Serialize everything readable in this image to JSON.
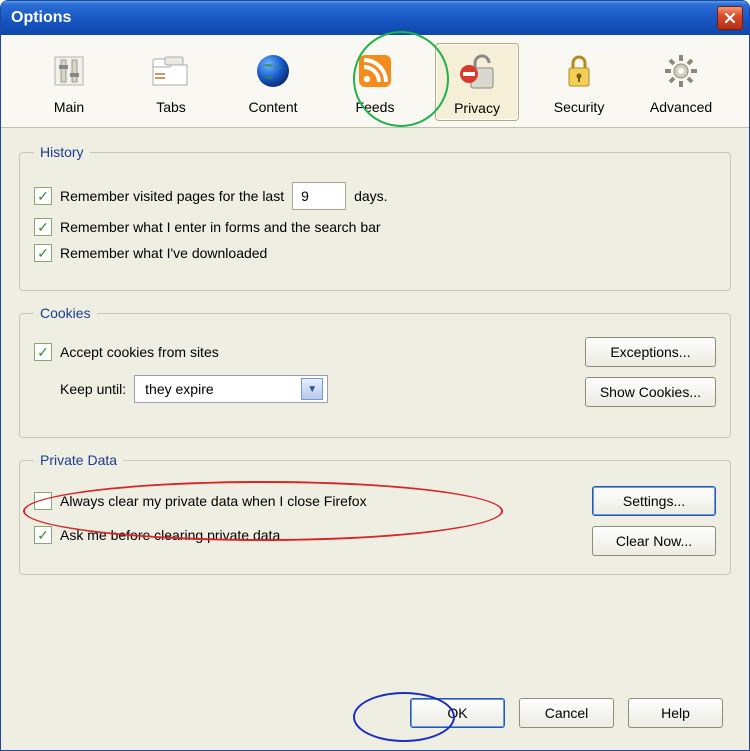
{
  "window": {
    "title": "Options"
  },
  "tabs": [
    {
      "label": "Main"
    },
    {
      "label": "Tabs"
    },
    {
      "label": "Content"
    },
    {
      "label": "Feeds"
    },
    {
      "label": "Privacy"
    },
    {
      "label": "Security"
    },
    {
      "label": "Advanced"
    }
  ],
  "history": {
    "legend": "History",
    "remember_visited_prefix": "Remember visited pages for the last",
    "remember_visited_suffix": "days.",
    "days_value": "9",
    "remember_forms": "Remember what I enter in forms and the search bar",
    "remember_downloads": "Remember what I've downloaded"
  },
  "cookies": {
    "legend": "Cookies",
    "accept": "Accept cookies from sites",
    "keep_until_label": "Keep until:",
    "keep_until_value": "they expire",
    "exceptions_btn": "Exceptions...",
    "show_cookies_btn": "Show Cookies..."
  },
  "private": {
    "legend": "Private Data",
    "always_clear": "Always clear my private data when I close Firefox",
    "ask_me": "Ask me before clearing private data",
    "settings_btn": "Settings...",
    "clear_now_btn": "Clear Now..."
  },
  "buttons": {
    "ok": "OK",
    "cancel": "Cancel",
    "help": "Help"
  }
}
